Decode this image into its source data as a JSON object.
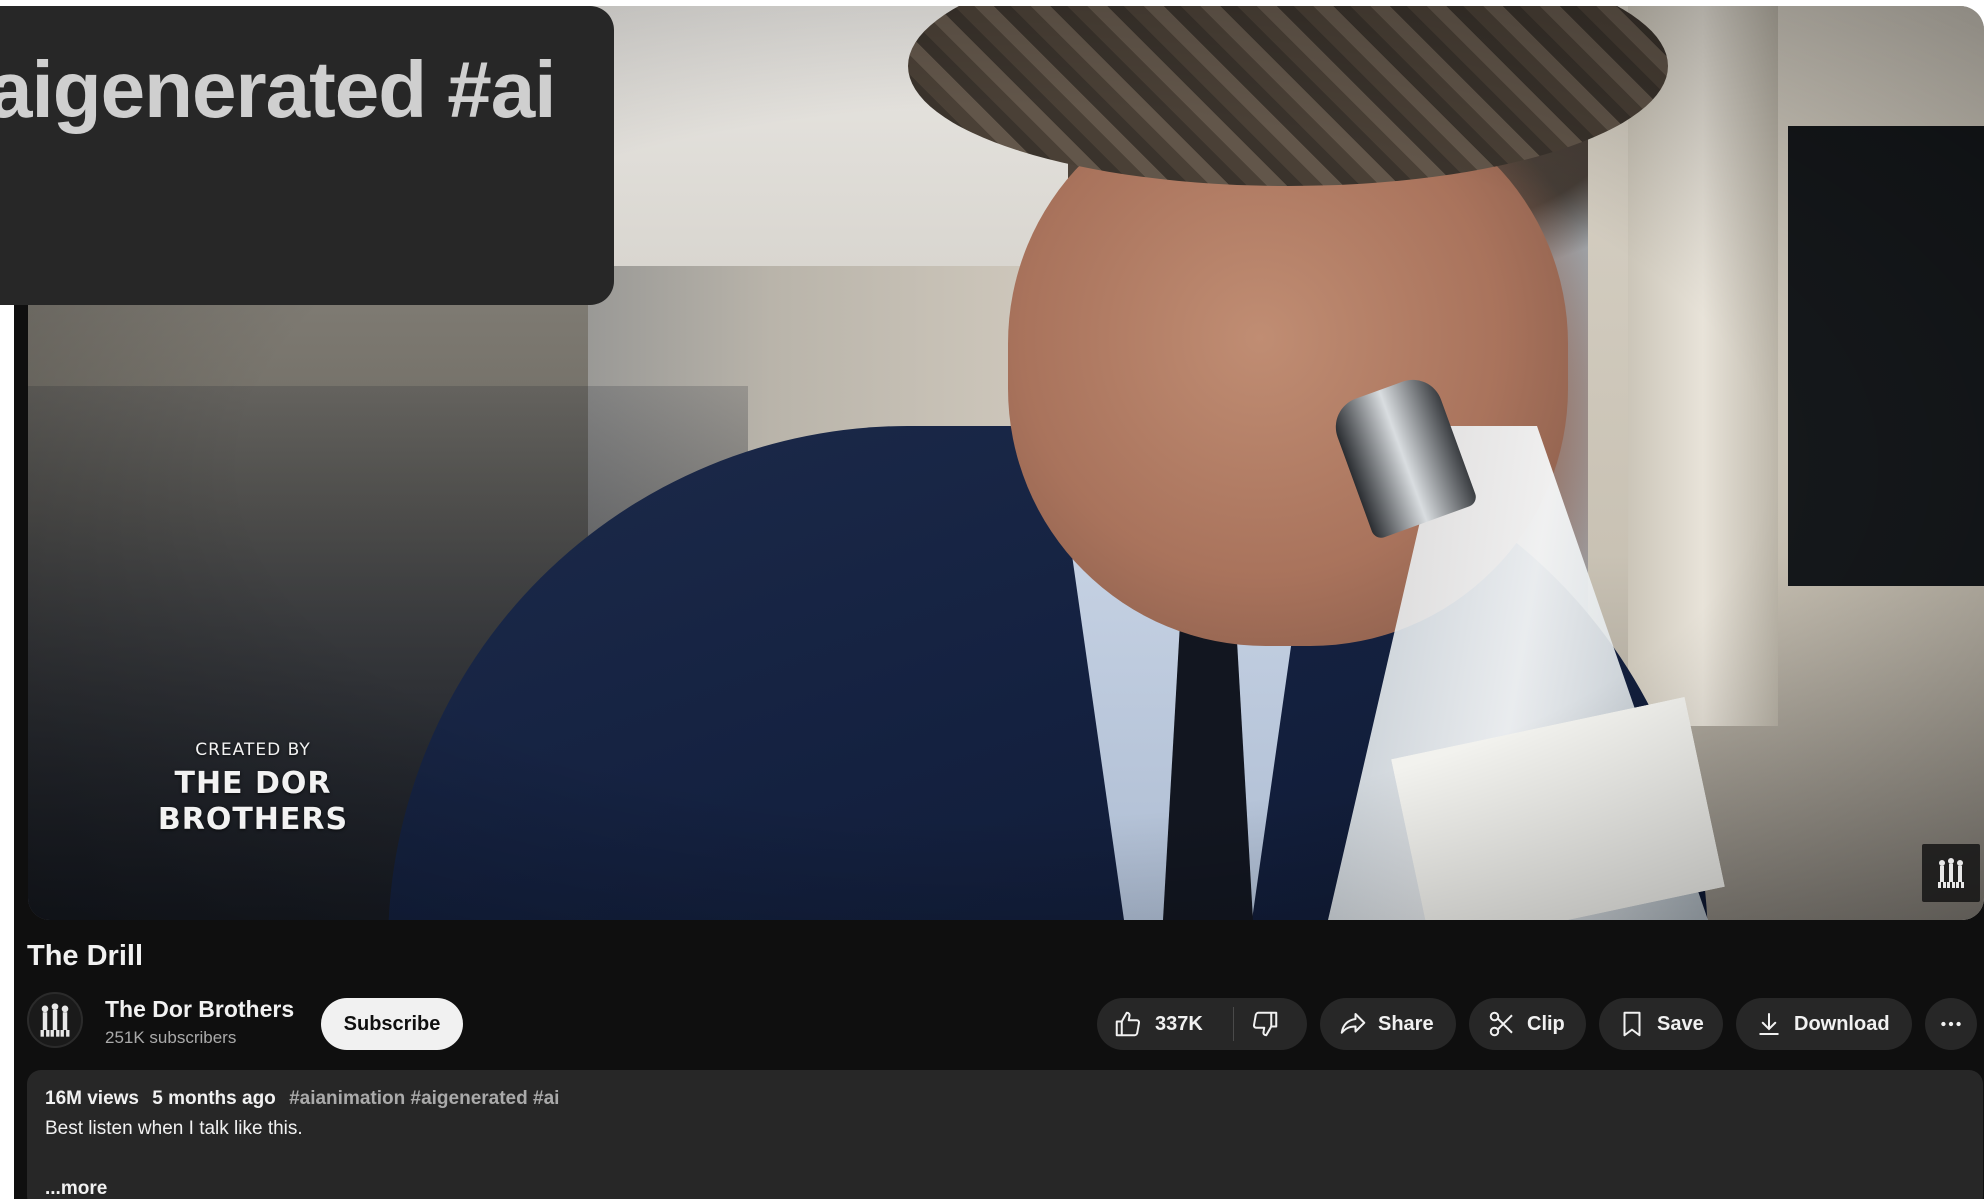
{
  "overlay": {
    "text": "aigenerated #ai"
  },
  "player": {
    "watermark_small": "CREATED BY",
    "watermark_line1": "THE DOR",
    "watermark_line2": "BROTHERS"
  },
  "video": {
    "title": "The Drill"
  },
  "channel": {
    "name": "The Dor Brothers",
    "subscribers": "251K subscribers",
    "subscribe_label": "Subscribe"
  },
  "actions": {
    "like_count": "337K",
    "share_label": "Share",
    "clip_label": "Clip",
    "save_label": "Save",
    "download_label": "Download"
  },
  "description": {
    "views": "16M views",
    "age": "5 months ago",
    "tags": "#aianimation #aigenerated #ai",
    "text": "Best listen when I talk like this.",
    "more_label": "...more"
  },
  "colors": {
    "page_bg": "#0f0f0f",
    "chip_bg": "#272727",
    "subscribe_bg": "#f1f1f1",
    "text_primary": "#f1f1f1",
    "text_secondary": "#aaaaaa"
  },
  "icons": [
    "thumbs-up-icon",
    "thumbs-down-icon",
    "share-arrow-icon",
    "scissors-icon",
    "bookmark-icon",
    "download-icon",
    "more-horizontal-icon",
    "channel-logo-icon"
  ]
}
